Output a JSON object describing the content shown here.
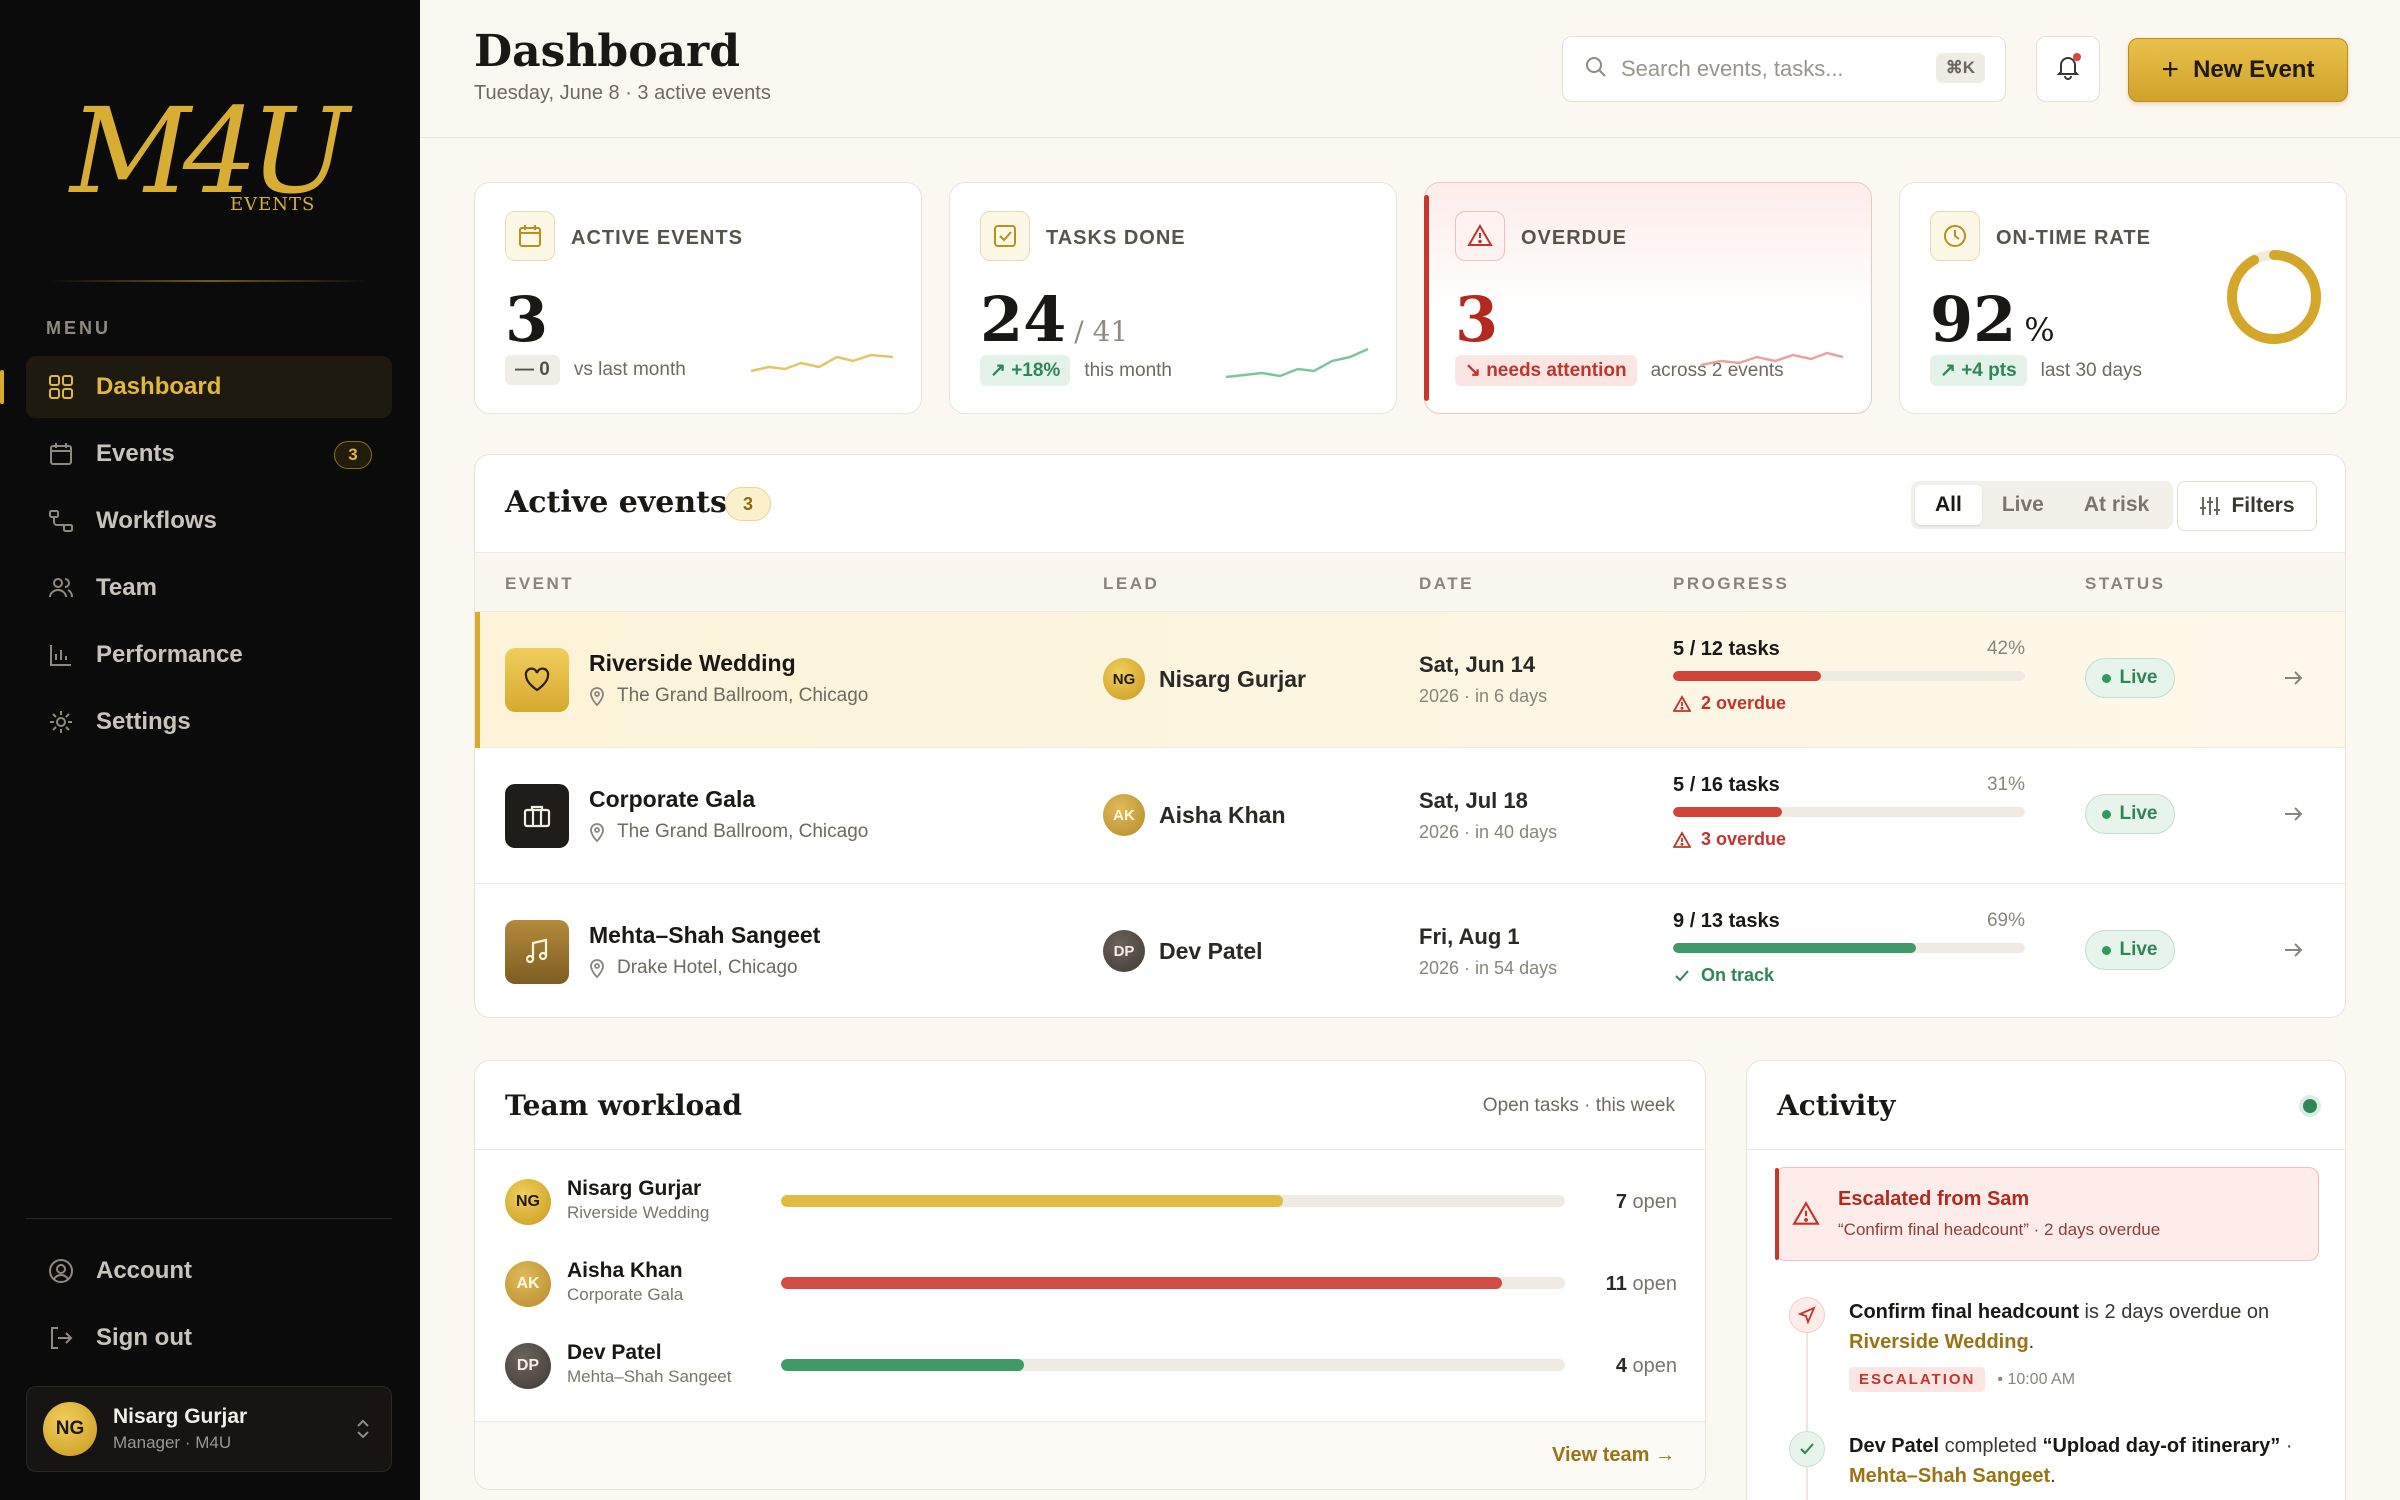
{
  "brand": {
    "logo_text": "M4U",
    "logo_sub": "EVENTS",
    "accent": "#d9aa2b"
  },
  "sidebar": {
    "menu_label": "MENU",
    "items": [
      {
        "label": "Dashboard",
        "icon": "grid-icon",
        "active": true
      },
      {
        "label": "Events",
        "icon": "calendar-icon",
        "badge": "3"
      },
      {
        "label": "Workflows",
        "icon": "workflow-icon"
      },
      {
        "label": "Team",
        "icon": "users-icon"
      },
      {
        "label": "Performance",
        "icon": "chart-icon"
      },
      {
        "label": "Settings",
        "icon": "gear-icon"
      }
    ],
    "bottom": [
      {
        "label": "Account",
        "icon": "user-circle-icon"
      },
      {
        "label": "Sign out",
        "icon": "sign-out-icon"
      }
    ],
    "user": {
      "initials": "NG",
      "name": "Nisarg Gurjar",
      "role": "Manager · M4U"
    }
  },
  "header": {
    "title": "Dashboard",
    "subtitle": "Tuesday, June 8 · 3 active events",
    "search_placeholder": "Search events, tasks...",
    "search_shortcut": "⌘K",
    "new_event_label": "New Event"
  },
  "stats": [
    {
      "label": "ACTIVE EVENTS",
      "value": "3",
      "delta": "— 0",
      "note": "vs last month"
    },
    {
      "label": "TASKS DONE",
      "value": "24",
      "suffix": "/ 41",
      "delta": "↗ +18%",
      "note": "this month"
    },
    {
      "label": "OVERDUE",
      "value": "3",
      "delta": "↘ needs attention",
      "note": "across 2 events"
    },
    {
      "label": "ON-TIME RATE",
      "value": "92",
      "suffix": "%",
      "delta": "↗ +4 pts",
      "note": "last 30 days",
      "ring_fraction": 0.92
    }
  ],
  "events_panel": {
    "title": "Active events",
    "count": "3",
    "segments": [
      "All",
      "Live",
      "At risk"
    ],
    "filters_label": "Filters",
    "columns": [
      "EVENT",
      "LEAD",
      "DATE",
      "PROGRESS",
      "STATUS"
    ],
    "rows": [
      {
        "name": "Riverside Wedding",
        "location": "The Grand Ballroom, Chicago",
        "icon": "heart-icon",
        "lead_initials": "NG",
        "lead": "Nisarg Gurjar",
        "date": "Sat, Jun 14",
        "date_sub": "2026 · in 6 days",
        "tasks_done": "5",
        "tasks_total": "/ 12 tasks",
        "percent": "42%",
        "progress": 0.42,
        "note": "2 overdue",
        "note_type": "overdue",
        "status": "Live"
      },
      {
        "name": "Corporate Gala",
        "location": "The Grand Ballroom, Chicago",
        "icon": "briefcase-icon",
        "lead_initials": "AK",
        "lead": "Aisha Khan",
        "date": "Sat, Jul 18",
        "date_sub": "2026 · in 40 days",
        "tasks_done": "5",
        "tasks_total": "/ 16 tasks",
        "percent": "31%",
        "progress": 0.31,
        "note": "3 overdue",
        "note_type": "overdue",
        "status": "Live"
      },
      {
        "name": "Mehta–Shah Sangeet",
        "location": "Drake Hotel, Chicago",
        "icon": "music-icon",
        "lead_initials": "DP",
        "lead": "Dev Patel",
        "date": "Fri, Aug 1",
        "date_sub": "2026 · in 54 days",
        "tasks_done": "9",
        "tasks_total": "/ 13 tasks",
        "percent": "69%",
        "progress": 0.69,
        "note": "On track",
        "note_type": "ok",
        "status": "Live"
      }
    ]
  },
  "team": {
    "title": "Team workload",
    "subtitle": "Open tasks · this week",
    "members": [
      {
        "initials": "NG",
        "name": "Nisarg Gurjar",
        "event": "Riverside Wedding",
        "open": "7",
        "open_label": "open",
        "load": 0.64
      },
      {
        "initials": "AK",
        "name": "Aisha Khan",
        "event": "Corporate Gala",
        "open": "11",
        "open_label": "open",
        "load": 0.92
      },
      {
        "initials": "DP",
        "name": "Dev Patel",
        "event": "Mehta–Shah Sangeet",
        "open": "4",
        "open_label": "open",
        "load": 0.31
      }
    ],
    "view_label": "View team →"
  },
  "activity": {
    "title": "Activity",
    "escalation_title": "Escalated from Sam",
    "escalation_sub": "“Confirm final headcount” · 2 days overdue",
    "items": [
      {
        "bold": "Confirm final headcount",
        "text": " is 2 days overdue on ",
        "link": "Riverside Wedding",
        "end": ".",
        "tag": "ESCALATION",
        "time": "• 10:00 AM"
      },
      {
        "bold": "Dev Patel",
        "text": " completed ",
        "bold2": "“Upload day-of itinerary”",
        "sep": " · ",
        "link": "Mehta–Shah Sangeet",
        "end": "."
      }
    ]
  }
}
